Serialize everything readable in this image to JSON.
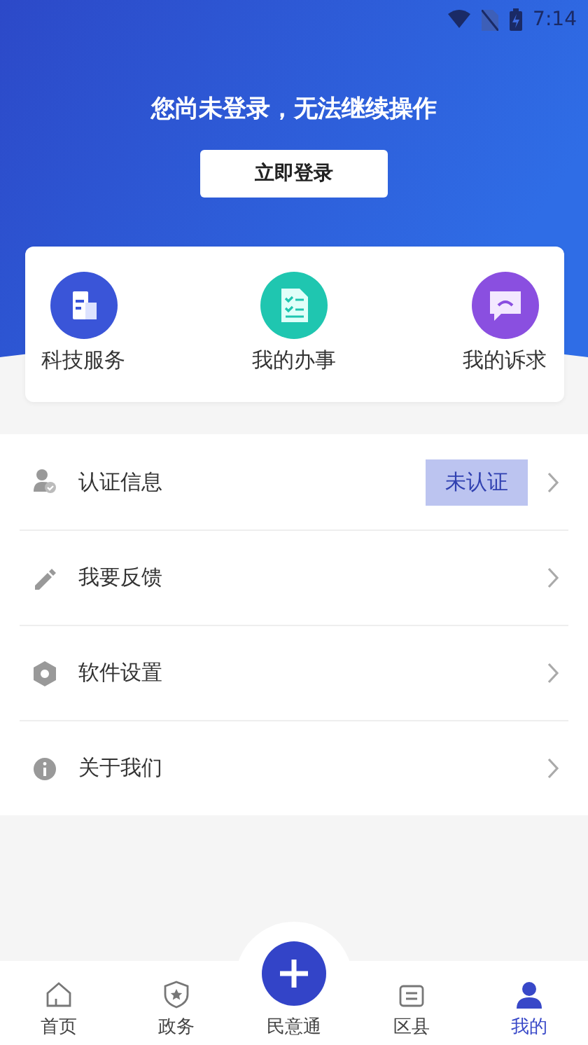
{
  "status_bar": {
    "time": "7:14"
  },
  "header": {
    "message": "您尚未登录，无法继续操作",
    "login_button": "立即登录"
  },
  "shortcuts": [
    {
      "kind": "service",
      "label": "科技服务",
      "color": "#3a55d8"
    },
    {
      "kind": "tasks",
      "label": "我的办事",
      "color": "#1fc6b0"
    },
    {
      "kind": "appeal",
      "label": "我的诉求",
      "color": "#8a4fe0"
    }
  ],
  "menu": [
    {
      "kind": "verify",
      "label": "认证信息",
      "badge": "未认证"
    },
    {
      "kind": "feedback",
      "label": "我要反馈"
    },
    {
      "kind": "settings",
      "label": "软件设置"
    },
    {
      "kind": "about",
      "label": "关于我们"
    }
  ],
  "bottom_nav": [
    {
      "kind": "home",
      "label": "首页",
      "selected": false
    },
    {
      "kind": "gov",
      "label": "政务",
      "selected": false
    },
    {
      "kind": "plus",
      "label": "民意通",
      "selected": false
    },
    {
      "kind": "district",
      "label": "区县",
      "selected": false
    },
    {
      "kind": "me",
      "label": "我的",
      "selected": true
    }
  ]
}
